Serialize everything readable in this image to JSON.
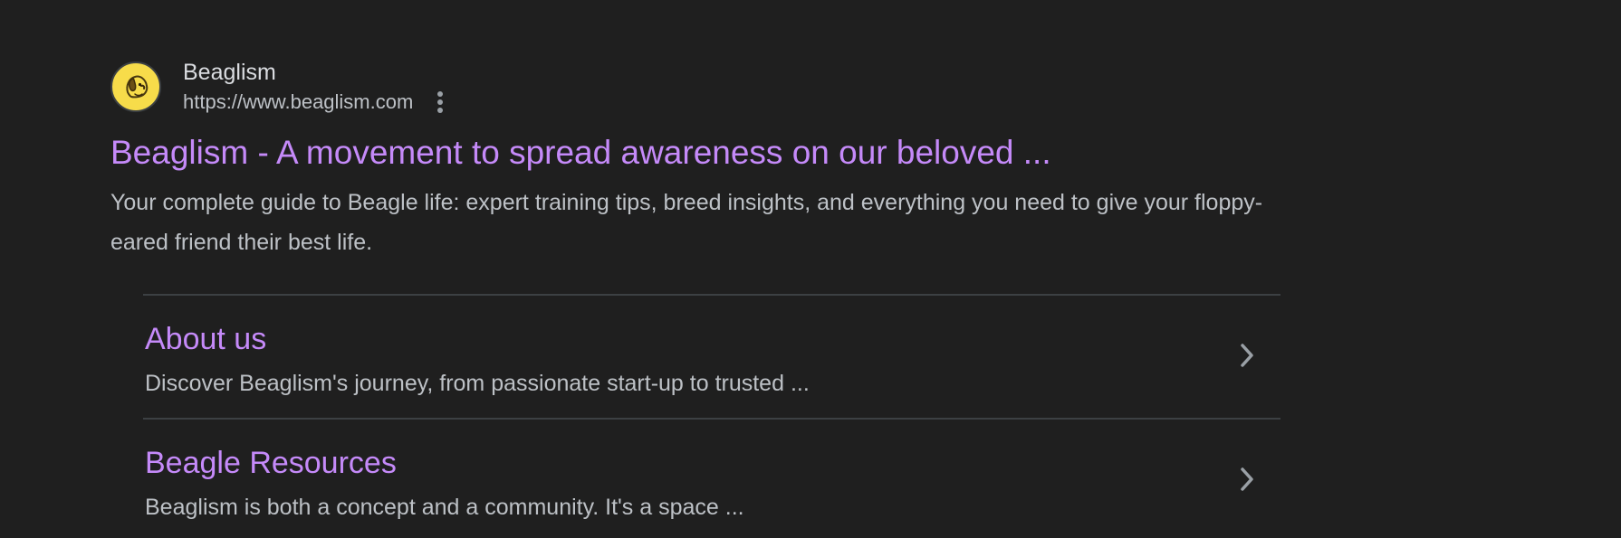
{
  "result": {
    "site_name": "Beaglism",
    "site_url": "https://www.beaglism.com",
    "title": "Beaglism - A movement to spread awareness on our beloved ...",
    "snippet": "Your complete guide to Beagle life: expert training tips, breed insights, and everything you need to give your floppy-eared friend their best life.",
    "favicon_icon": "beagle-head-icon",
    "more_icon": "three-dots-vertical-icon"
  },
  "sitelinks": [
    {
      "title": "About us",
      "description": "Discover Beaglism's journey, from passionate start-up to trusted ...",
      "icon": "chevron-right-icon"
    },
    {
      "title": "Beagle Resources",
      "description": "Beaglism is both a concept and a community. It's a space ...",
      "icon": "chevron-right-icon"
    }
  ],
  "colors": {
    "background": "#1f1f1f",
    "link": "#c58af9",
    "text_primary": "#dadce0",
    "text_secondary": "#bdc1c6",
    "divider": "#3c4043",
    "favicon_bg": "#f7dc4a"
  }
}
